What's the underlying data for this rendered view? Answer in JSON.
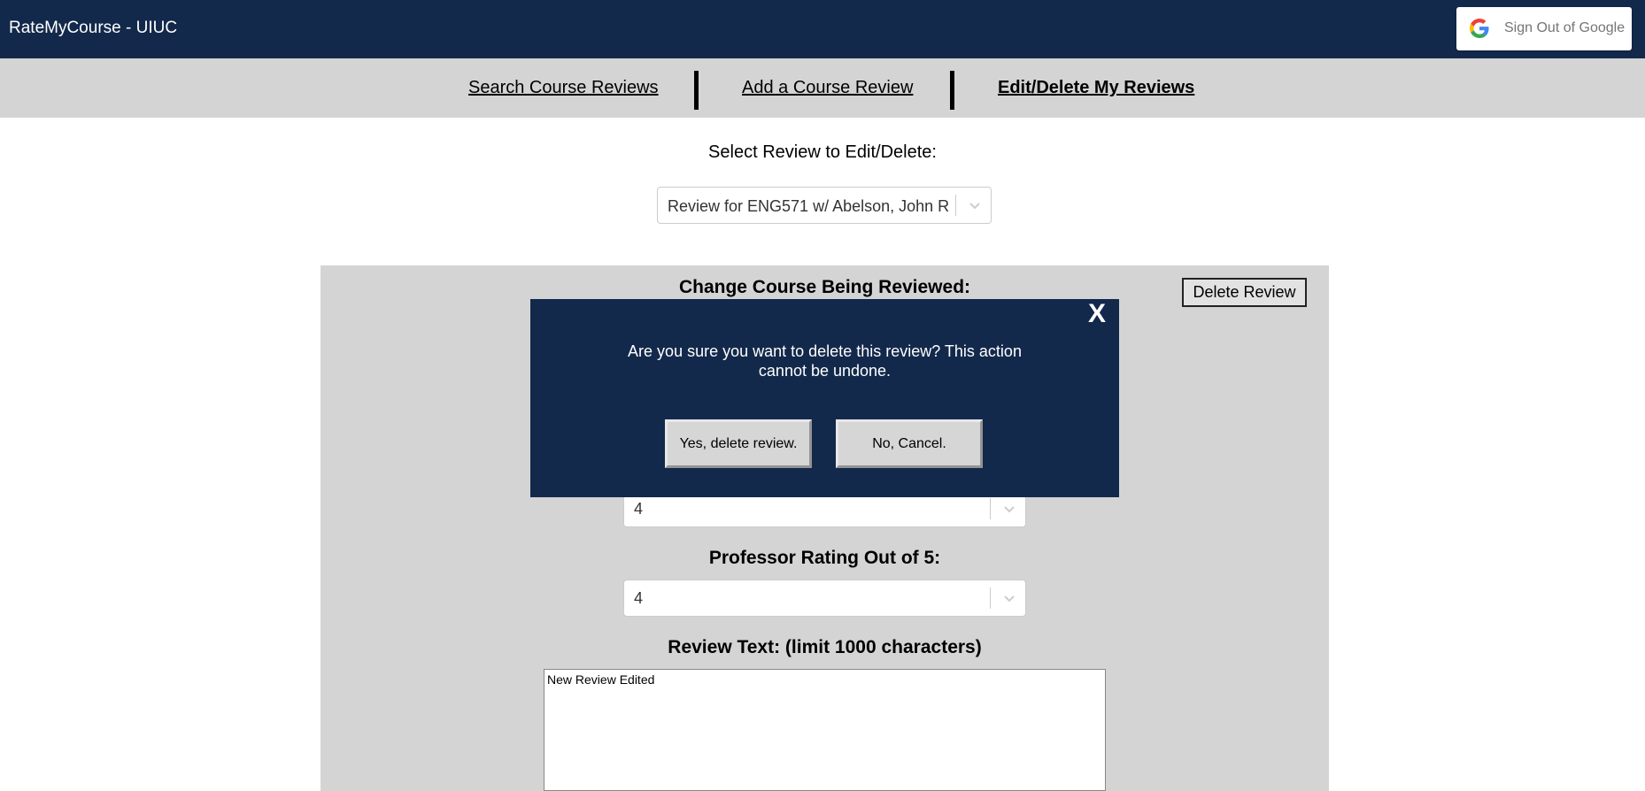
{
  "app": {
    "title": "RateMyCourse - UIUC"
  },
  "google": {
    "label": "Sign Out of Google"
  },
  "nav": {
    "search": "Search Course Reviews",
    "add": "Add a Course Review",
    "edit": "Edit/Delete My Reviews"
  },
  "select_review": {
    "label": "Select Review to Edit/Delete:",
    "value": "Review for ENG571 w/ Abelson, John R"
  },
  "panel": {
    "title": "Change Course Being Reviewed:",
    "delete_label": "Delete Review",
    "course_rating_value": "4",
    "professor_label": "Professor Rating Out of 5:",
    "professor_value": "4",
    "review_text_label": "Review Text: (limit 1000 characters)",
    "review_text_value": "New Review Edited"
  },
  "modal": {
    "close": "X",
    "message": "Are you sure you want to delete this review? This action cannot be undone.",
    "confirm_label": "Yes, delete review.",
    "cancel_label": "No, Cancel."
  },
  "colors": {
    "header_bg": "#13294b",
    "nav_bg": "#d4d4d4",
    "modal_bg": "#13294b"
  }
}
